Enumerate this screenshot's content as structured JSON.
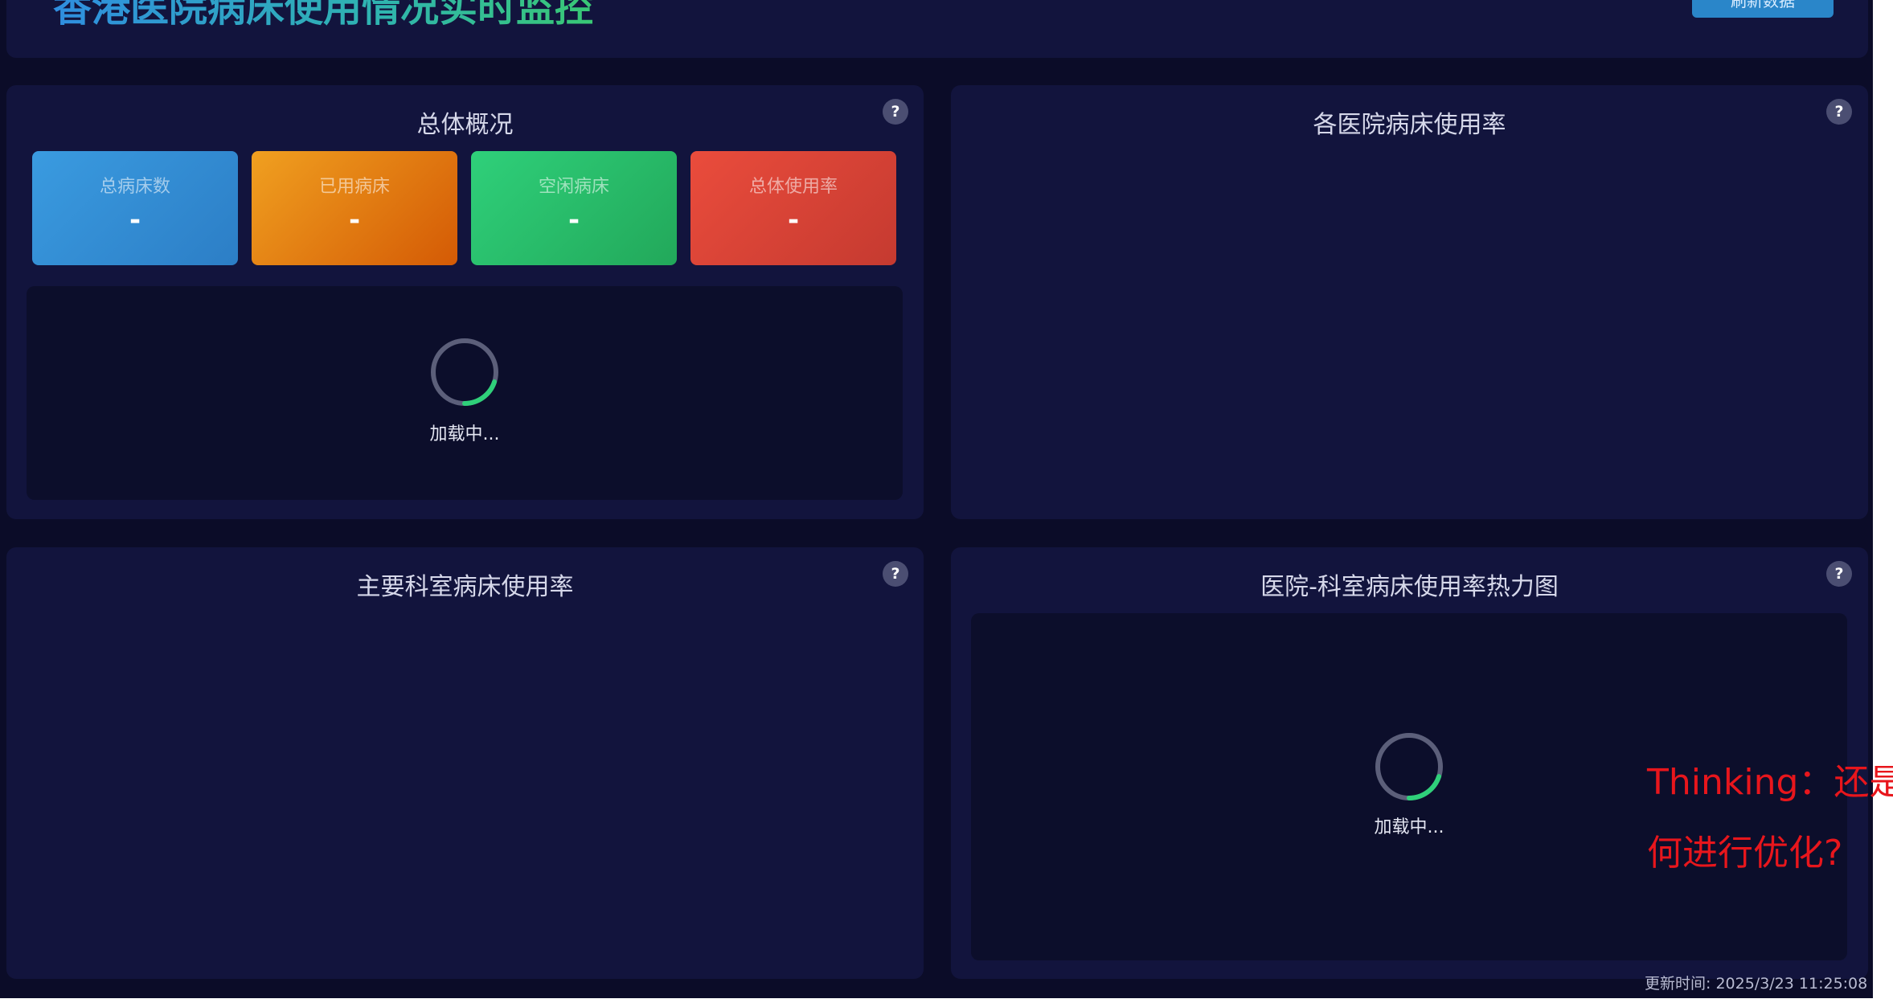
{
  "header": {
    "title": "香港医院病床使用情况实时监控",
    "button_label": "刷新数据"
  },
  "panels": {
    "overview": {
      "title": "总体概况",
      "help": "?",
      "stats": [
        {
          "label": "总病床数",
          "value": "-",
          "color": "#3a9be0"
        },
        {
          "label": "已用病床",
          "value": "-",
          "color": "#f0a020"
        },
        {
          "label": "空闲病床",
          "value": "-",
          "color": "#2fd07a"
        },
        {
          "label": "总体使用率",
          "value": "-",
          "color": "#ea4c3c"
        }
      ],
      "loading_text": "加载中..."
    },
    "hospital_usage": {
      "title": "各医院病床使用率",
      "help": "?"
    },
    "department_usage": {
      "title": "主要科室病床使用率",
      "help": "?"
    },
    "heatmap": {
      "title": "医院-科室病床使用率热力图",
      "help": "?",
      "loading_text": "加载中..."
    }
  },
  "annotation": {
    "line1": "Thinking：还是",
    "line2": "何进行优化?"
  },
  "footer": {
    "update_time": "更新时间: 2025/3/23 11:25:08"
  },
  "colors": {
    "background": "#0b0c28",
    "panel": "#12143d",
    "spinner_accent": "#2fd07a",
    "annotation": "#e8161c"
  }
}
